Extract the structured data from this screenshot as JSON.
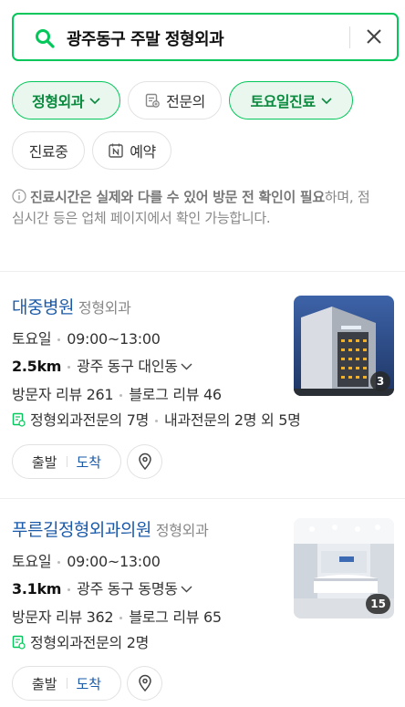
{
  "search": {
    "query": "광주동구 주말 정형외과"
  },
  "filters": [
    {
      "label": "정형외과",
      "active": true,
      "dropdown": true
    },
    {
      "label": "전문의",
      "active": false,
      "icon": "specialist-icon"
    },
    {
      "label": "토요일진료",
      "active": true,
      "dropdown": true
    },
    {
      "label": "진료중",
      "active": false
    },
    {
      "label": "예약",
      "active": false,
      "icon": "naver-booking-icon"
    }
  ],
  "notice": {
    "bold": "진료시간은 실제와 다를 수 있어 방문 전 확인이 필요",
    "rest": "하며, 점심시간 등은 업체 페이지에서 확인 가능합니다."
  },
  "places": [
    {
      "name": "대중병원",
      "category": "정형외과",
      "day": "토요일",
      "hours": "09:00~13:00",
      "distance": "2.5km",
      "address": "광주 동구 대인동",
      "visitor_review": "방문자 리뷰 261",
      "blog_review": "블로그 리뷰 46",
      "specialists": "정형외과전문의 7명",
      "specialists_more": "내과전문의 2명 외 5명",
      "photo_count": "3",
      "depart": "출발",
      "arrive": "도착"
    },
    {
      "name": "푸른길정형외과의원",
      "category": "정형외과",
      "day": "토요일",
      "hours": "09:00~13:00",
      "distance": "3.1km",
      "address": "광주 동구 동명동",
      "visitor_review": "방문자 리뷰 362",
      "blog_review": "블로그 리뷰 65",
      "specialists": "정형외과전문의 2명",
      "photo_count": "15",
      "depart": "출발",
      "arrive": "도착"
    }
  ],
  "colors": {
    "accent": "#03c75a",
    "link": "#1a5aaa"
  }
}
